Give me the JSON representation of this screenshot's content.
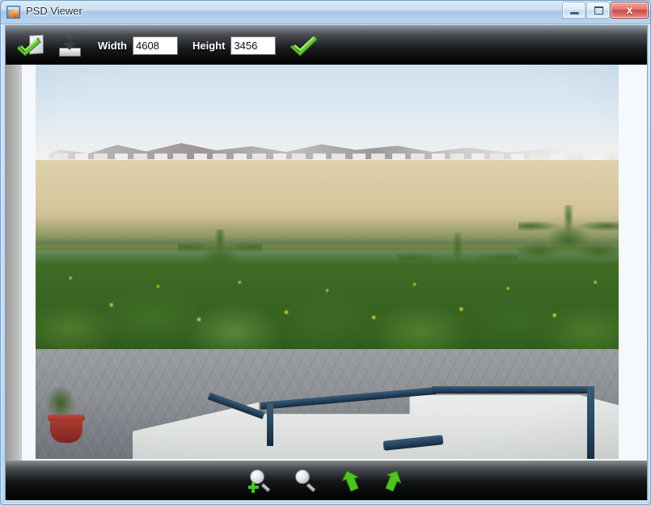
{
  "window": {
    "title": "PSD Viewer",
    "icon": "psd-image-icon",
    "controls": {
      "minimize": "minimize-button",
      "maximize": "maximize-button",
      "close_label": "x"
    }
  },
  "toolbar_top": {
    "open_icon": "check-document-icon",
    "save_icon": "save-download-icon",
    "width_label": "Width",
    "width_value": "4608",
    "height_label": "Height",
    "height_value": "3456",
    "apply_icon": "green-check-icon"
  },
  "toolbar_bottom": {
    "zoom_in_icon": "magnifier-plus-icon",
    "zoom_out_icon": "magnifier-icon",
    "rotate_left_icon": "rotate-left-arrow-icon",
    "rotate_right_icon": "rotate-right-arrow-icon"
  },
  "viewport": {
    "image_description": "Resort garden landscape: pale blue sky over distant desert mountains and white buildings, sandy plain, palm trees and green shrubs with yellow flowers, grey cobblestone pavement, red planter, and a white stairwell with dark blue railing"
  },
  "colors": {
    "accent_green": "#5cc62e",
    "toolbar_dark": "#000000",
    "titlebar_blue": "#bcd4ea",
    "close_red": "#c94a40",
    "input_background": "#ffffff"
  }
}
